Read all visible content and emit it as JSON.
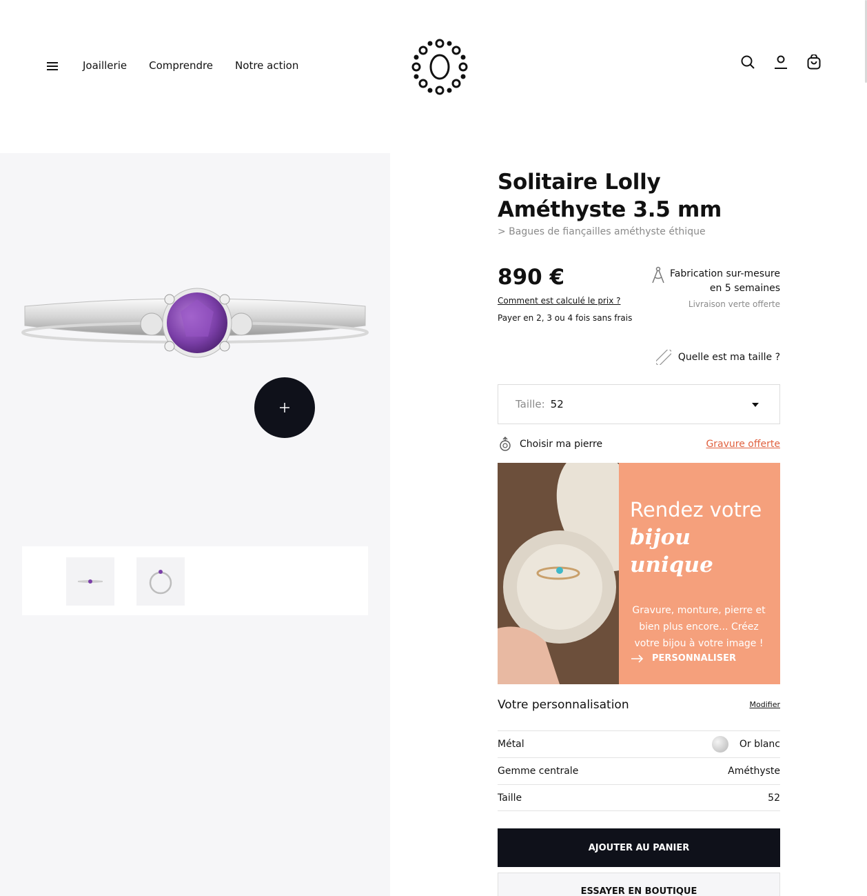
{
  "header": {
    "nav": [
      "Joaillerie",
      "Comprendre",
      "Notre action"
    ]
  },
  "product": {
    "title": "Solitaire Lolly Améthyste 3.5 mm",
    "breadcrumb": "> Bagues de fiançailles améthyste éthique",
    "price": "890 €",
    "price_link": "Comment est calculé le prix ?",
    "payment": "Payer en 2, 3 ou 4 fois sans frais",
    "fabrication_line1": "Fabrication sur-mesure",
    "fabrication_line2": "en 5 semaines",
    "delivery": "Livraison verte offerte",
    "size_help": "Quelle est ma taille ?",
    "size_label": "Taille:",
    "size_value": "52",
    "choose_stone": "Choisir ma pierre",
    "engraving": "Gravure offerte"
  },
  "promo": {
    "heading": "Rendez votre",
    "heading_em": "bijou unique",
    "text": "Gravure, monture, pierre et bien plus encore... Créez votre bijou à votre image !",
    "cta": "PERSONNALISER"
  },
  "personalisation": {
    "title": "Votre personnalisation",
    "edit": "Modifier",
    "rows": [
      {
        "label": "Métal",
        "value": "Or blanc"
      },
      {
        "label": "Gemme centrale",
        "value": "Améthyste"
      },
      {
        "label": "Taille",
        "value": "52"
      }
    ]
  },
  "actions": {
    "add_to_cart": "AJOUTER AU PANIER",
    "try_in_store": "ESSAYER EN BOUTIQUE"
  },
  "colors": {
    "dark": "#0f111a",
    "accent": "#e0603e",
    "promo_bg": "#f5a07c",
    "amethyst": "#7b3fa8"
  },
  "icons": [
    "menu-icon",
    "search-icon",
    "user-icon",
    "bag-icon",
    "compass-icon",
    "ruler-icon",
    "gem-icon",
    "plus-icon",
    "arrow-right-icon"
  ]
}
